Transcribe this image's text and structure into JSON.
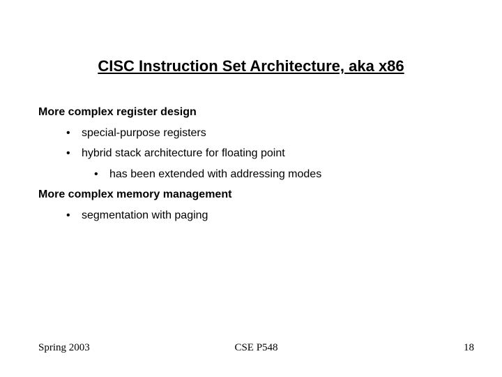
{
  "title": "CISC Instruction Set Architecture, aka x86",
  "sections": [
    {
      "heading": "More complex register design",
      "bullets": [
        {
          "level": 1,
          "text": "special-purpose registers"
        },
        {
          "level": 1,
          "text": "hybrid stack architecture for floating point"
        },
        {
          "level": 2,
          "text": "has been extended with addressing modes"
        }
      ]
    },
    {
      "heading": "More complex memory management",
      "bullets": [
        {
          "level": 1,
          "text": "segmentation with paging"
        }
      ]
    }
  ],
  "footer": {
    "left": "Spring 2003",
    "center": "CSE P548",
    "right": "18"
  }
}
